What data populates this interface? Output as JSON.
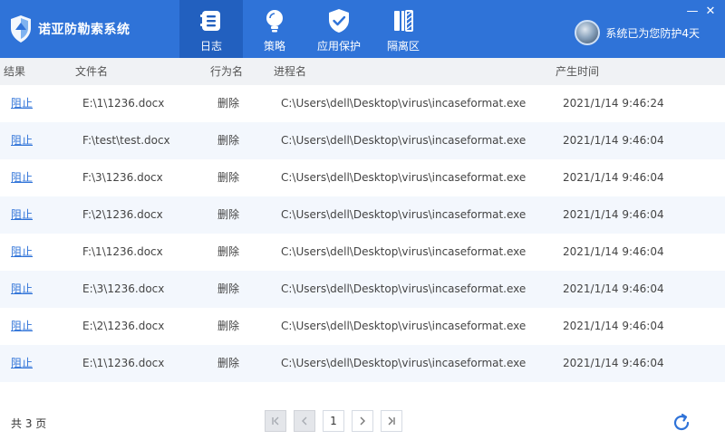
{
  "app": {
    "title": "诺亚防勒索系统",
    "protect_text": "系统已为您防护4天"
  },
  "nav": [
    {
      "label": "日志",
      "icon": "log-icon",
      "active": true
    },
    {
      "label": "策略",
      "icon": "bulb-icon",
      "active": false
    },
    {
      "label": "应用保护",
      "icon": "shield-check-icon",
      "active": false
    },
    {
      "label": "隔离区",
      "icon": "quarantine-icon",
      "active": false
    }
  ],
  "window": {
    "minimize": "—",
    "close": "✕"
  },
  "table": {
    "headers": {
      "result": "结果",
      "file": "文件名",
      "action": "行为名",
      "process": "进程名",
      "time": "产生时间"
    },
    "rows": [
      {
        "result": "阻止",
        "file": "E:\\1\\1236.docx",
        "action": "删除",
        "process": "C:\\Users\\dell\\Desktop\\virus\\incaseformat.exe",
        "time": "2021/1/14 9:46:24"
      },
      {
        "result": "阻止",
        "file": "F:\\test\\test.docx",
        "action": "删除",
        "process": "C:\\Users\\dell\\Desktop\\virus\\incaseformat.exe",
        "time": "2021/1/14 9:46:04"
      },
      {
        "result": "阻止",
        "file": "F:\\3\\1236.docx",
        "action": "删除",
        "process": "C:\\Users\\dell\\Desktop\\virus\\incaseformat.exe",
        "time": "2021/1/14 9:46:04"
      },
      {
        "result": "阻止",
        "file": "F:\\2\\1236.docx",
        "action": "删除",
        "process": "C:\\Users\\dell\\Desktop\\virus\\incaseformat.exe",
        "time": "2021/1/14 9:46:04"
      },
      {
        "result": "阻止",
        "file": "F:\\1\\1236.docx",
        "action": "删除",
        "process": "C:\\Users\\dell\\Desktop\\virus\\incaseformat.exe",
        "time": "2021/1/14 9:46:04"
      },
      {
        "result": "阻止",
        "file": "E:\\3\\1236.docx",
        "action": "删除",
        "process": "C:\\Users\\dell\\Desktop\\virus\\incaseformat.exe",
        "time": "2021/1/14 9:46:04"
      },
      {
        "result": "阻止",
        "file": "E:\\2\\1236.docx",
        "action": "删除",
        "process": "C:\\Users\\dell\\Desktop\\virus\\incaseformat.exe",
        "time": "2021/1/14 9:46:04"
      },
      {
        "result": "阻止",
        "file": "E:\\1\\1236.docx",
        "action": "删除",
        "process": "C:\\Users\\dell\\Desktop\\virus\\incaseformat.exe",
        "time": "2021/1/14 9:46:04"
      }
    ]
  },
  "footer": {
    "page_count": "共 3 页",
    "current_page": "1"
  },
  "colors": {
    "titlebar": "#2f73d8",
    "nav_active": "#2260bf",
    "row_alt": "#f3f7fd",
    "link": "#2f73d8"
  }
}
